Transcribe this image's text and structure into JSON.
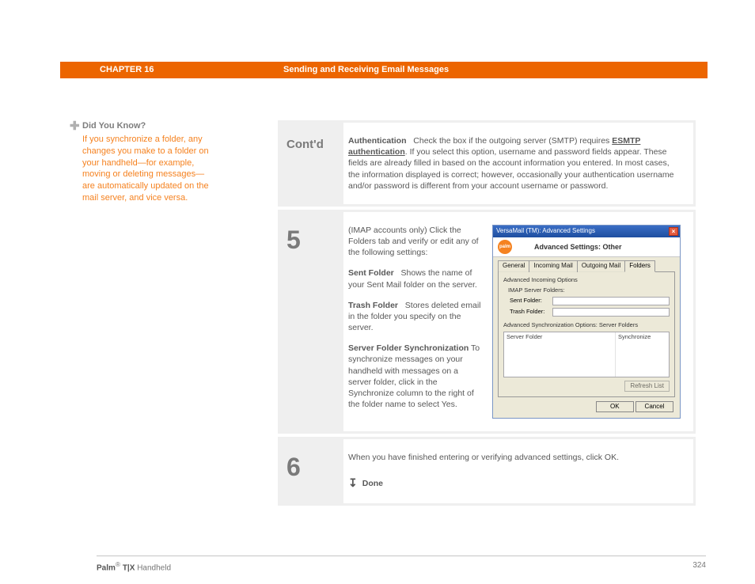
{
  "header": {
    "chapter": "CHAPTER 16",
    "title": "Sending and Receiving Email Messages"
  },
  "sidebar": {
    "heading": "Did You Know?",
    "body": "If you synchronize a folder, any changes you make to a folder on your handheld—for example, moving or deleting messages—are automatically updated on the mail server, and vice versa."
  },
  "steps": {
    "contd": {
      "label": "Cont'd",
      "auth_label": "Authentication",
      "auth_pre": "Check the box if the outgoing server (SMTP) requires ",
      "auth_link": "ESMTP authentication",
      "auth_post": ". If you select this option, username and password fields appear. These fields are already filled in based on the account information you entered. In most cases, the information displayed is correct; however, occasionally your authentication username and/or password is different from your account username or password."
    },
    "s5": {
      "num": "5",
      "intro": "(IMAP accounts only) Click the Folders tab and verify or edit any of the following settings:",
      "sent_label": "Sent Folder",
      "sent_body": "Shows the name of your Sent Mail folder on the server.",
      "trash_label": "Trash Folder",
      "trash_body": "Stores deleted email in the folder you specify on the server.",
      "sync_label": "Server Folder Synchronization",
      "sync_body": "To synchronize messages on your handheld with messages on a server folder, click in the Synchronize column to the right of the folder name to select Yes."
    },
    "s6": {
      "num": "6",
      "body": "When you have finished entering or verifying advanced settings, click OK.",
      "done": "Done"
    }
  },
  "dialog": {
    "title": "VersaMail (TM): Advanced Settings",
    "logo": "palm",
    "heading": "Advanced Settings: Other",
    "tabs": [
      "General",
      "Incoming Mail",
      "Outgoing Mail",
      "Folders"
    ],
    "group1": "Advanced Incoming Options",
    "sub1": "IMAP Server Folders:",
    "sent_label": "Sent Folder:",
    "trash_label": "Trash Folder:",
    "group2": "Advanced Synchronization Options: Server Folders",
    "col1": "Server Folder",
    "col2": "Synchronize",
    "refresh": "Refresh List",
    "ok": "OK",
    "cancel": "Cancel"
  },
  "footer": {
    "left_bold": "Palm",
    "left_sup": "®",
    "left_mid": " T|X ",
    "left_tail": "Handheld",
    "page": "324"
  }
}
